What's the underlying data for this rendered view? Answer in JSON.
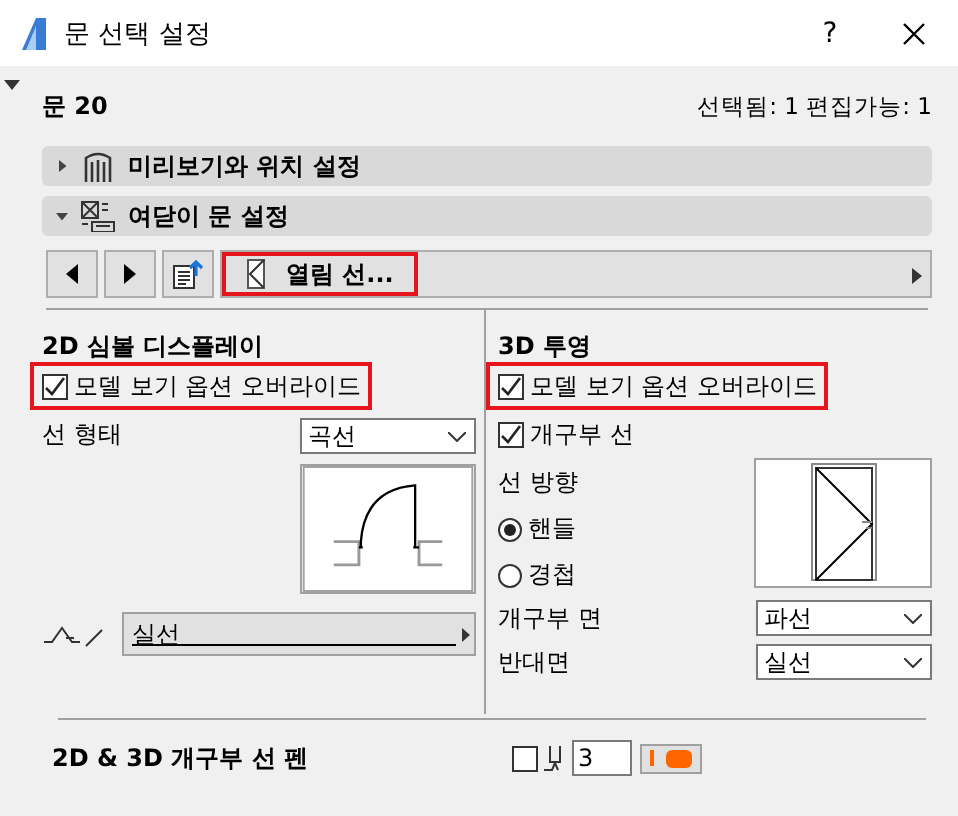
{
  "window": {
    "title": "문 선택 설정",
    "help": "?"
  },
  "element": {
    "name": "문 20",
    "selection_info": "선택됨: 1 편집가능: 1"
  },
  "panels": [
    {
      "label": "미리보기와 위치 설정",
      "expanded": false
    },
    {
      "label": "여닫이 문 설정",
      "expanded": true
    }
  ],
  "toolbar": {
    "page": {
      "label": "열림 선...",
      "highlighted": true
    }
  },
  "symbol_2d": {
    "title": "2D 심볼 디스플레이",
    "override": {
      "label": "모델 보기 옵션 오버라이드",
      "checked": true,
      "highlighted": true
    },
    "line_shape": {
      "label": "선 형태",
      "value": "곡선"
    },
    "line_type": {
      "value": "실선"
    }
  },
  "projection_3d": {
    "title": "3D 투영",
    "override": {
      "label": "모델 보기 옵션 오버라이드",
      "checked": true,
      "highlighted": true
    },
    "opening_lines": {
      "label": "개구부 선",
      "checked": true,
      "highlighted": false
    },
    "direction": {
      "label": "선 방향",
      "options": [
        {
          "label": "핸들",
          "selected": true
        },
        {
          "label": "경첩",
          "selected": false
        }
      ]
    },
    "front": {
      "label": "개구부 면",
      "value": "파선"
    },
    "back": {
      "label": "반대면",
      "value": "실선"
    }
  },
  "pen": {
    "label": "2D & 3D 개구부 선 펜",
    "checked": false,
    "value": "3",
    "color": "#ff6600"
  }
}
